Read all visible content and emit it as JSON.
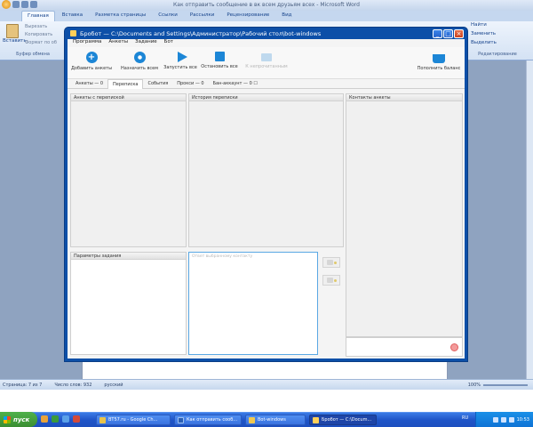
{
  "word": {
    "title": "Как отправить сообщение в вк всем друзьям всех - Microsoft Word",
    "tabs": [
      "Главная",
      "Вставка",
      "Разметка страницы",
      "Ссылки",
      "Рассылки",
      "Рецензирование",
      "Вид"
    ],
    "clipboard": {
      "paste": "Вставить",
      "cut": "Вырезать",
      "copy": "Копировать",
      "format": "Формат по об",
      "group": "Буфер обмена"
    },
    "editing": {
      "find": "Найти",
      "replace": "Заменить",
      "select": "Выделить",
      "group": "Редактирование"
    },
    "status": {
      "page": "Страница: 7 из 7",
      "words": "Число слов: 932",
      "lang": "русский",
      "zoom": "100%"
    }
  },
  "taskbar": {
    "start": "пуск",
    "tasks": [
      {
        "label": "BT57.ru - Google Ch..."
      },
      {
        "label": "Как отправить сооб..."
      },
      {
        "label": "Bot-windows"
      },
      {
        "label": "Бробот — C:\\Docum..."
      }
    ],
    "lang": "RU",
    "time": "10:53"
  },
  "brobot": {
    "title": "Бробот — C:\\Documents and Settings\\Администратор\\Рабочий стол\\bot-windows",
    "menu": [
      "Программа",
      "Анкеты",
      "Задание",
      "Бот"
    ],
    "toolbar": {
      "add": "Добавить анкеты",
      "assign": "Назначить всем",
      "run": "Запустить все",
      "stop": "Остановить все",
      "unread": "К непрочитанным",
      "balance": "Пополнить баланс"
    },
    "tabs": [
      "Анкеты — 0",
      "Переписка",
      "События",
      "Прокси — 0",
      "Бан-аккаунт — 0 ☐"
    ],
    "panels": {
      "profiles": "Анкеты с перепиской",
      "history": "История переписки",
      "contacts": "Контакты анкеты",
      "params": "Параметры задания"
    },
    "reply_placeholder": "Ответ выбранному контакту"
  },
  "colors": {
    "accent": "#1c86d6",
    "window_frame": "#0c4fa8",
    "taskbar": "#245edb"
  }
}
